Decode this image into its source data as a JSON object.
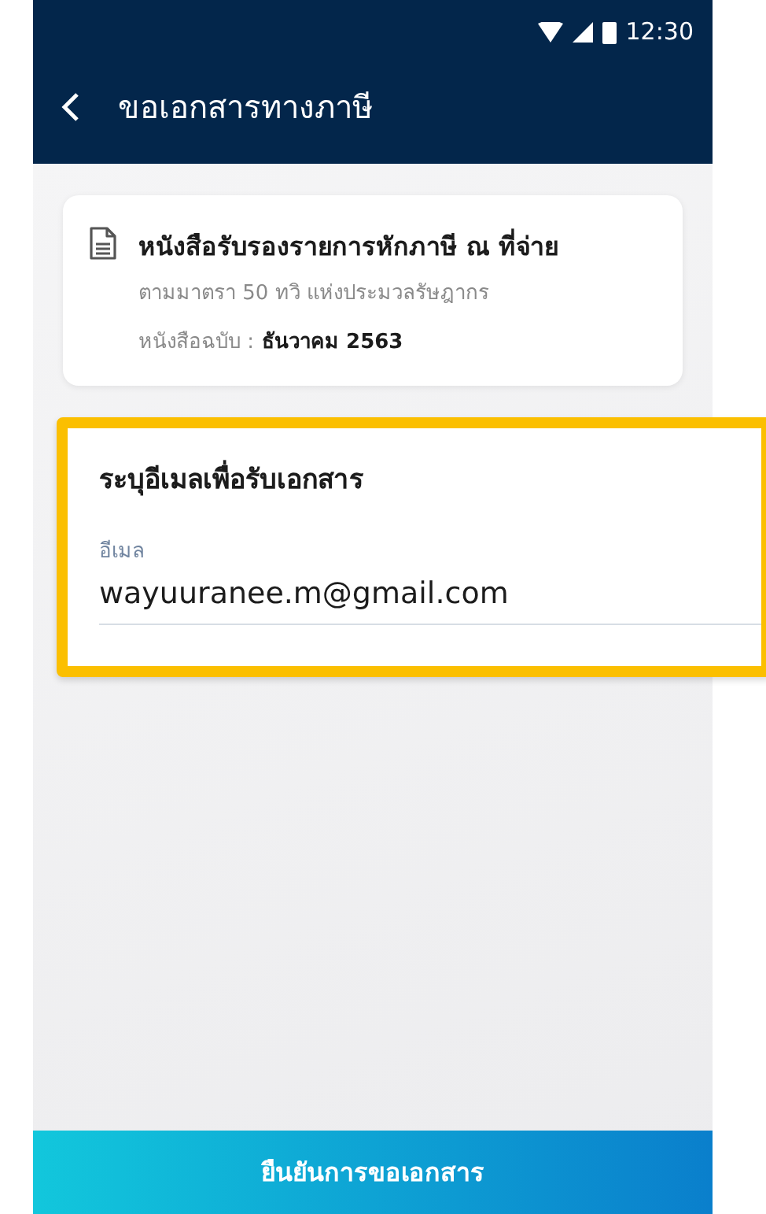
{
  "status_bar": {
    "time": "12:30"
  },
  "app_bar": {
    "title": "ขอเอกสารทางภาษี"
  },
  "document_card": {
    "title": "หนังสือรับรองรายการหักภาษี ณ ที่จ่าย",
    "subtitle": "ตามมาตรา 50 ทวิ แห่งประมวลรัษฎากร",
    "issue_label": "หนังสือฉบับ :",
    "issue_value": "ธันวาคม 2563"
  },
  "email_card": {
    "heading": "ระบุอีเมลเพื่อรับเอกสาร",
    "field_label": "อีเมล",
    "value": "wayuuranee.m@gmail.com",
    "highlighted": true
  },
  "confirm_button": "ยืนยันการขอเอกสาร"
}
